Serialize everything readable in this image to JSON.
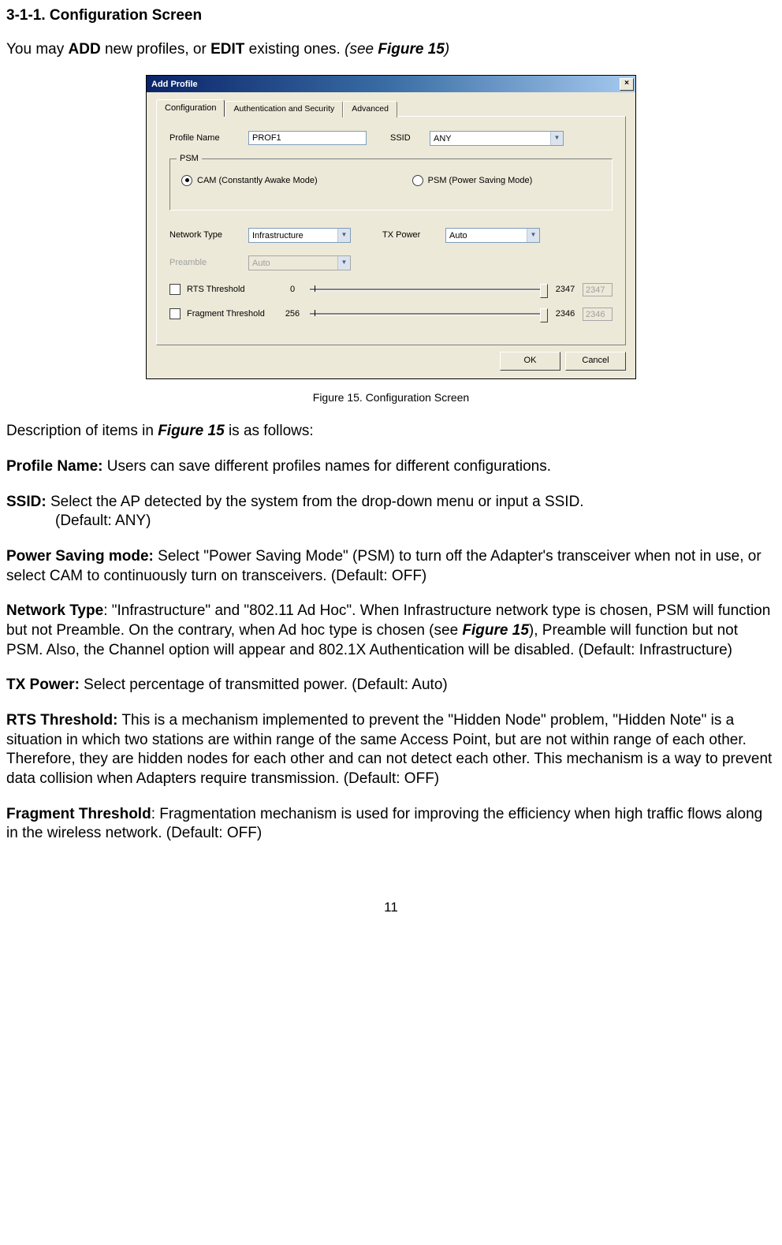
{
  "heading": "3-1-1. Configuration Screen",
  "intro_parts": {
    "p1": "You may ",
    "add": "ADD",
    "p2": " new profiles, or ",
    "edit": "EDIT",
    "p3": " existing ones. ",
    "p4": "(",
    "p5": "see ",
    "figref": "Figure 15",
    "p6": ")"
  },
  "dialog": {
    "title": "Add Profile",
    "close": "×",
    "tabs": [
      "Configuration",
      "Authentication and Security",
      "Advanced"
    ],
    "profile_name_label": "Profile Name",
    "profile_name_value": "PROF1",
    "ssid_label": "SSID",
    "ssid_value": "ANY",
    "psm_legend": "PSM",
    "cam_label": "CAM (Constantly Awake Mode)",
    "psm_label": "PSM (Power Saving Mode)",
    "network_type_label": "Network Type",
    "network_type_value": "Infrastructure",
    "txpower_label": "TX Power",
    "txpower_value": "Auto",
    "preamble_label": "Preamble",
    "preamble_value": "Auto",
    "rts_label": "RTS Threshold",
    "rts_min": "0",
    "rts_max": "2347",
    "rts_val": "2347",
    "frag_label": "Fragment Threshold",
    "frag_min": "256",
    "frag_max": "2346",
    "frag_val": "2346",
    "ok": "OK",
    "cancel": "Cancel"
  },
  "caption": "Figure 15.    Configuration Screen",
  "desc_intro": {
    "p1": "Description of items in ",
    "figref": "Figure 15",
    "p2": " is as follows:"
  },
  "items": {
    "profile_name": {
      "label": "Profile Name:",
      "text": "    Users can save different profiles names for different configurations."
    },
    "ssid": {
      "label": "SSID:",
      "text": "    Select the AP detected by the system from the drop-down menu or input a SSID.",
      "line2": "(Default: ANY)"
    },
    "psm": {
      "label": "Power Saving mode:",
      "text": "    Select \"Power Saving Mode\" (PSM) to turn off the Adapter's transceiver when not in use, or select CAM to continuously turn on transceivers. (Default: OFF)"
    },
    "network_type": {
      "label": "Network Type",
      "colon": ":",
      "text": "    \"Infrastructure\" and \"802.11 Ad Hoc\". When Infrastructure network type is chosen, PSM will function but not Preamble. On the contrary, when Ad hoc type is chosen (see ",
      "figref": "Figure 15",
      "text2": "), Preamble will function but not PSM. Also, the Channel option will appear and 802.1X Authentication will be disabled. (Default: Infrastructure)"
    },
    "tx_power": {
      "label": "TX Power:",
      "text": "    Select percentage of transmitted power. (Default: Auto)"
    },
    "rts": {
      "label": "RTS Threshold:",
      "text": "    This is a mechanism implemented to prevent the \"Hidden Node\" problem, \"Hidden Note\" is a situation in which two stations are within range of the same Access Point, but are not within range of each other. Therefore, they are hidden nodes for each other and can not detect each other. This mechanism is a way to prevent data collision when Adapters require transmission. (Default: OFF)"
    },
    "frag": {
      "label": "Fragment Threshold",
      "colon": ":",
      "text": "    Fragmentation mechanism is used for improving the efficiency when high traffic flows along in the wireless network. (Default: OFF)"
    }
  },
  "page_number": "11"
}
